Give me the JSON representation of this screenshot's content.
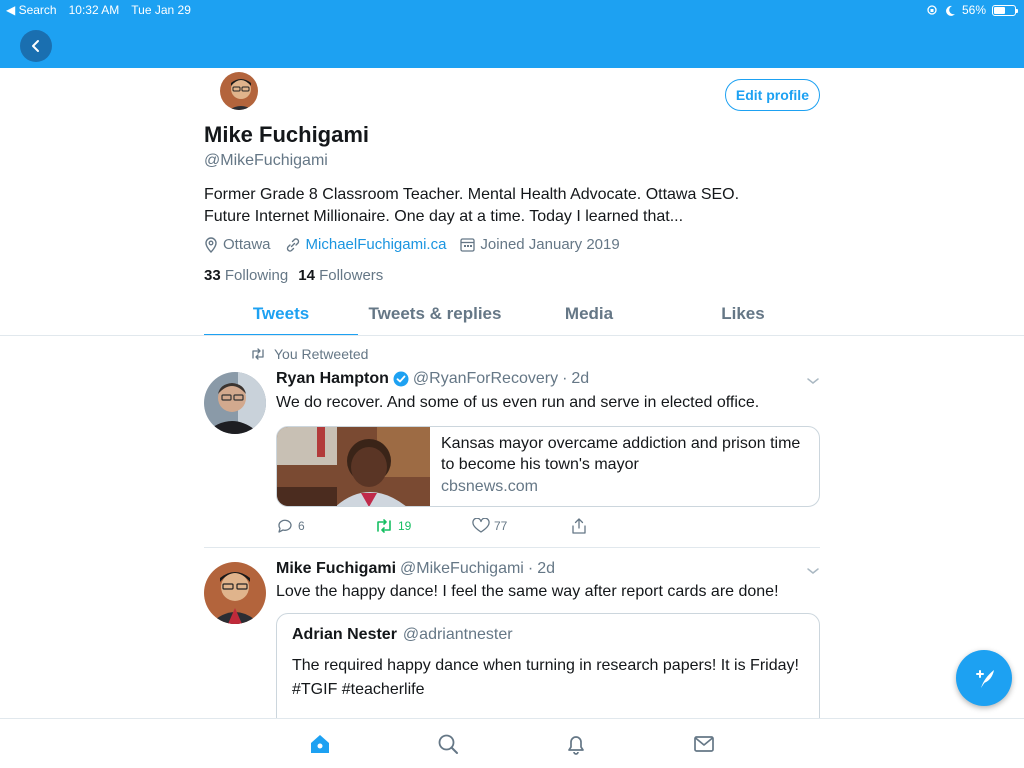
{
  "status_bar": {
    "back_label": "Search",
    "time": "10:32 AM",
    "date": "Tue Jan 29",
    "battery": "56%",
    "battery_level": 0.56
  },
  "profile": {
    "name": "Mike Fuchigami",
    "handle": "@MikeFuchigami",
    "edit_label": "Edit profile",
    "bio_line1": "Former Grade 8 Classroom Teacher. Mental Health Advocate. Ottawa SEO.",
    "bio_line2": "Future Internet Millionaire. One day at a time. Today I learned that...",
    "location": "Ottawa",
    "website": "MichaelFuchigami.ca",
    "joined": "Joined January 2019",
    "following_count": "33",
    "following_label": "Following",
    "followers_count": "14",
    "followers_label": "Followers"
  },
  "tabs": [
    {
      "label": "Tweets",
      "active": true
    },
    {
      "label": "Tweets & replies",
      "active": false
    },
    {
      "label": "Media",
      "active": false
    },
    {
      "label": "Likes",
      "active": false
    }
  ],
  "tweets": [
    {
      "retweet_label": "You Retweeted",
      "name": "Ryan Hampton",
      "handle": "@RyanForRecovery",
      "sep": "·",
      "time": "2d",
      "text": "We do recover. And some of us even run and serve in elected office.",
      "card": {
        "title": "Kansas mayor overcame addiction and prison time to become his town's mayor",
        "domain": "cbsnews.com"
      },
      "replies": "6",
      "retweets": "19",
      "likes": "77"
    },
    {
      "name": "Mike Fuchigami",
      "handle": "@MikeFuchigami",
      "sep": "·",
      "time": "2d",
      "text": "Love the happy dance! I feel the same way after report cards are done!",
      "quote": {
        "name": "Adrian Nester",
        "handle": "@adriantnester",
        "text": "The required happy dance when turning in research papers! It is Friday! #TGIF #teacherlife"
      }
    }
  ],
  "colors": {
    "brand": "#1da1f2",
    "retweet_green": "#17bf63",
    "secondary_text": "#657786"
  },
  "icons": {
    "back": "chevron-left-icon",
    "location": "location-pin-icon",
    "link": "link-icon",
    "calendar": "calendar-icon",
    "retweet": "retweet-icon",
    "verified": "verified-badge-icon",
    "reply": "reply-icon",
    "like": "heart-icon",
    "share": "share-icon",
    "compose": "compose-tweet-icon",
    "home": "home-icon",
    "search": "search-icon",
    "notifications": "bell-icon",
    "messages": "mail-icon"
  }
}
